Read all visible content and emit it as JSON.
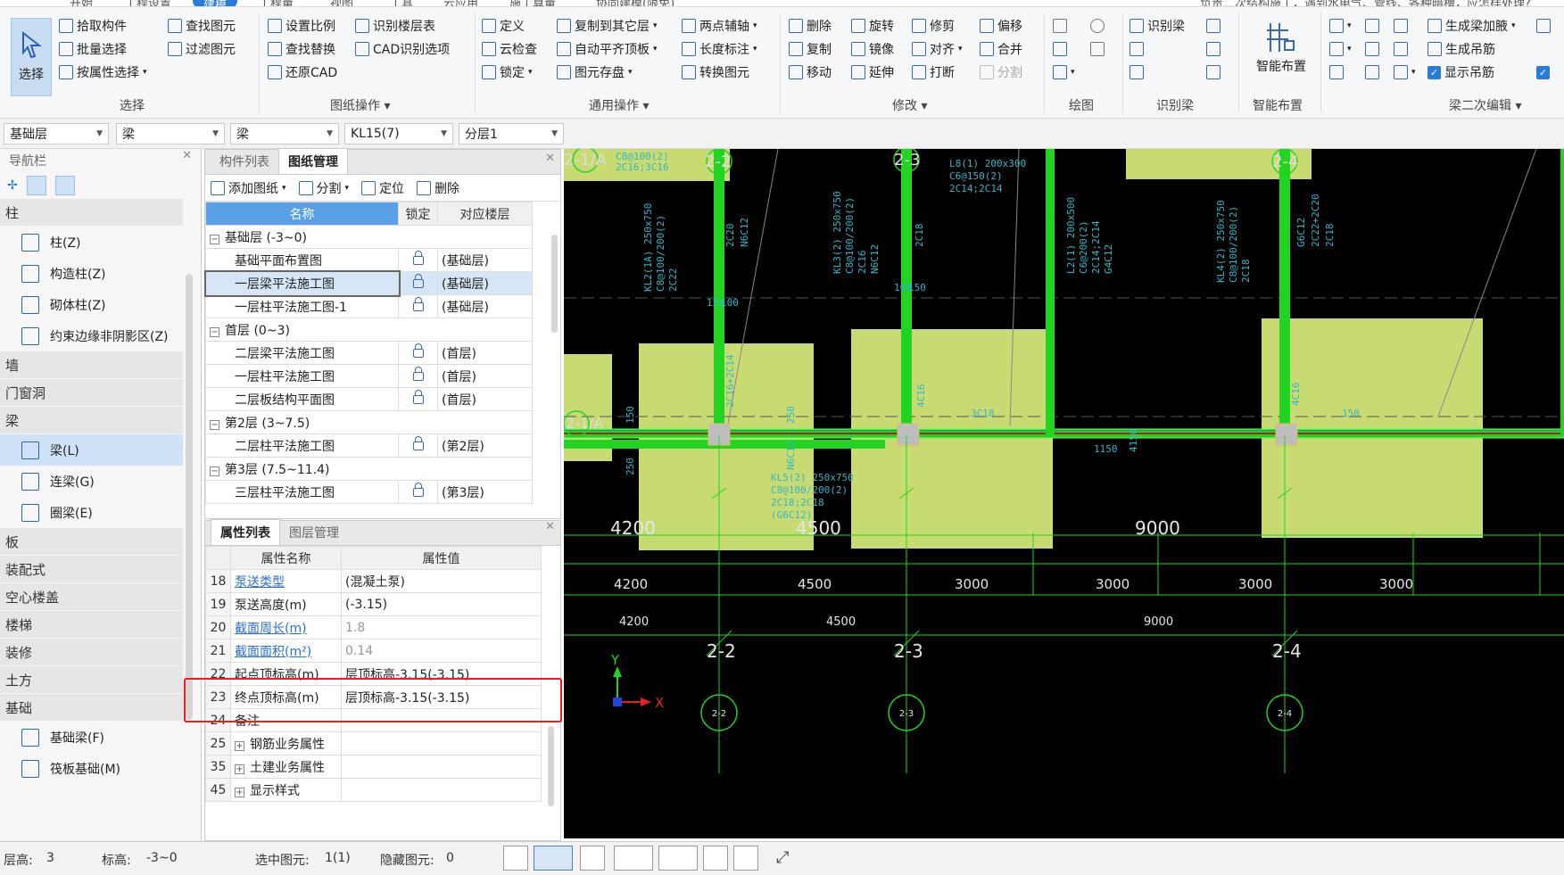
{
  "top_tabs": [
    {
      "label": "开始"
    },
    {
      "label": "工程设置"
    },
    {
      "label": "建模",
      "active": true
    },
    {
      "label": "视图"
    },
    {
      "label": "工程量"
    },
    {
      "label": "工具"
    },
    {
      "label": "云应用"
    },
    {
      "label": "施工算量"
    },
    {
      "label": "协同建模(限免)"
    }
  ],
  "top_right_text": "负责二次结构施工，遇到水电气、管线、各种暗槽，应怎样处理?",
  "ribbon": {
    "select_big": "选择",
    "groups": {
      "select": {
        "label": "选择",
        "items": [
          "拾取构件",
          "批量选择",
          "按属性选择",
          "查找图元",
          "过滤图元"
        ]
      },
      "drawing_ops": {
        "label": "图纸操作",
        "items": [
          "设置比例",
          "识别楼层表",
          "查找替换",
          "CAD识别选项",
          "还原CAD"
        ]
      },
      "common": {
        "label": "通用操作",
        "items": [
          "定义",
          "复制到其它层",
          "两点辅轴",
          "云检查",
          "自动平齐顶板",
          "长度标注",
          "锁定",
          "图元存盘",
          "转换图元"
        ]
      },
      "modify": {
        "label": "修改",
        "items": [
          "删除",
          "旋转",
          "修剪",
          "偏移",
          "复制",
          "镜像",
          "对齐",
          "合并",
          "移动",
          "延伸",
          "打断",
          "分割"
        ]
      },
      "draw": {
        "label": "绘图"
      },
      "recognize": {
        "label": "识别梁",
        "items": [
          "识别梁"
        ]
      },
      "smart": {
        "label": "智能布置",
        "items": [
          "智能布置"
        ]
      },
      "beam2": {
        "label": "梁二次编辑",
        "items": [
          "生成梁加腋",
          "生成吊筋",
          "显示吊筋"
        ]
      }
    }
  },
  "selectors": {
    "floor": "基础层",
    "category": "梁",
    "type": "梁",
    "element": "KL15(7)",
    "layer": "分层1"
  },
  "nav": {
    "title": "导航栏",
    "sections": [
      {
        "name": "柱",
        "items": [
          "柱(Z)",
          "构造柱(Z)",
          "砌体柱(Z)",
          "约束边缘非阴影区(Z)"
        ]
      },
      {
        "name": "墙",
        "items": []
      },
      {
        "name": "门窗洞",
        "items": []
      },
      {
        "name": "梁",
        "items": [
          "梁(L)",
          "连梁(G)",
          "圈梁(E)"
        ]
      },
      {
        "name": "板",
        "items": []
      },
      {
        "name": "装配式",
        "items": []
      },
      {
        "name": "空心楼盖",
        "items": []
      },
      {
        "name": "楼梯",
        "items": []
      },
      {
        "name": "装修",
        "items": []
      },
      {
        "name": "土方",
        "items": []
      },
      {
        "name": "基础",
        "items": [
          "基础梁(F)",
          "筏板基础(M)"
        ]
      }
    ],
    "selected_item": "梁(L)"
  },
  "drawing_panel": {
    "tabs": [
      "构件列表",
      "图纸管理"
    ],
    "active_tab": "图纸管理",
    "toolbar": [
      "添加图纸",
      "分割",
      "定位",
      "删除"
    ],
    "columns": [
      "名称",
      "锁定",
      "对应楼层"
    ],
    "rows": [
      {
        "kind": "group",
        "name": "基础层 (-3~0)"
      },
      {
        "kind": "item",
        "name": "基础平面布置图",
        "floor": "(基础层)"
      },
      {
        "kind": "item",
        "name": "一层梁平法施工图",
        "floor": "(基础层)",
        "selected": true
      },
      {
        "kind": "item",
        "name": "一层柱平法施工图-1",
        "floor": "(基础层)"
      },
      {
        "kind": "group",
        "name": "首层 (0~3)"
      },
      {
        "kind": "item",
        "name": "二层梁平法施工图",
        "floor": "(首层)"
      },
      {
        "kind": "item",
        "name": "一层柱平法施工图",
        "floor": "(首层)"
      },
      {
        "kind": "item",
        "name": "二层板结构平面图",
        "floor": "(首层)"
      },
      {
        "kind": "group",
        "name": "第2层 (3~7.5)"
      },
      {
        "kind": "item",
        "name": "二层柱平法施工图",
        "floor": "(第2层)"
      },
      {
        "kind": "group",
        "name": "第3层 (7.5~11.4)"
      },
      {
        "kind": "item",
        "name": "三层柱平法施工图",
        "floor": "(第3层)"
      }
    ]
  },
  "property_panel": {
    "tabs": [
      "属性列表",
      "图层管理"
    ],
    "active_tab": "属性列表",
    "columns": [
      "属性名称",
      "属性值"
    ],
    "rows": [
      {
        "no": "18",
        "name": "泵送类型",
        "value": "(混凝土泵)",
        "blue": true,
        "gray": false
      },
      {
        "no": "19",
        "name": "泵送高度(m)",
        "value": "(-3.15)",
        "blue": false,
        "gray": false
      },
      {
        "no": "20",
        "name": "截面周长(m)",
        "value": "1.8",
        "blue": true,
        "gray": true
      },
      {
        "no": "21",
        "name": "截面面积(m²)",
        "value": "0.14",
        "blue": true,
        "gray": true
      },
      {
        "no": "22",
        "name": "起点顶标高(m)",
        "value": "层顶标高-3.15(-3.15)",
        "blue": false,
        "gray": false
      },
      {
        "no": "23",
        "name": "终点顶标高(m)",
        "value": "层顶标高-3.15(-3.15)",
        "blue": false,
        "gray": false
      },
      {
        "no": "24",
        "name": "备注",
        "value": "",
        "blue": false,
        "gray": false
      },
      {
        "no": "25",
        "name": "钢筋业务属性",
        "value": "",
        "blue": false,
        "gray": false,
        "expand": true
      },
      {
        "no": "35",
        "name": "土建业务属性",
        "value": "",
        "blue": false,
        "gray": false,
        "expand": true
      },
      {
        "no": "45",
        "name": "显示样式",
        "value": "",
        "blue": false,
        "gray": false,
        "expand": true
      }
    ]
  },
  "cad": {
    "axis_labels_top": [
      "2-1/A",
      "2-2",
      "2-3",
      "2-4"
    ],
    "axis_label_left": "2-1/A",
    "spans_big": [
      "4200",
      "4500",
      "9000"
    ],
    "spans_row1": [
      "4200",
      "4500",
      "3000",
      "3000",
      "3000",
      "3000"
    ],
    "spans_row2": [
      "4200",
      "4500",
      "9000"
    ],
    "axis_labels_bottom": [
      "2-2",
      "2-3",
      "2-4"
    ],
    "circle_labels": [
      "2-2",
      "2-3",
      "2-4"
    ],
    "beam_notes": [
      "KL2(1A) 250x750",
      "C8@100/200(2)",
      "2C22",
      "KL3(2) 250x750",
      "C8@100/200(2)",
      "2C16",
      "N6C12",
      "L8(1) 200x300",
      "C6@150(2)",
      "2C14;2C14",
      "L2(1) 200x500",
      "C6@200(2)",
      "2C14;2C14",
      "G4C12",
      "KL4(2) 250x750",
      "C8@100/200(2)",
      "2C18",
      "KL5(2) 250x750",
      "C8@100/200(2)",
      "2C18;2C18",
      "(G6C12)",
      "C8@100(2)",
      "2C16;3C16",
      "2C20",
      "N6C12",
      "2C18",
      "2C18",
      "G6C12",
      "2C22+2C20",
      "2C16+2C14",
      "4C16",
      "3C18",
      "4C16",
      "150",
      "150",
      "100",
      "100",
      "150",
      "150",
      "250",
      "250",
      "N6C12",
      "1150",
      "4150"
    ],
    "compass": {
      "y": "Y",
      "x": "X"
    }
  },
  "status": {
    "floor_height_label": "层高:",
    "floor_height": "3",
    "elevation_label": "标高:",
    "elevation": "-3~0",
    "selected_label": "选中图元:",
    "selected": "1(1)",
    "hidden_label": "隐藏图元:",
    "hidden": "0"
  },
  "colors": {
    "accent": "#2a7bd8",
    "beam_green": "#22d322",
    "pile_fill": "#c8da72",
    "red_highlight": "#e8211f",
    "canvas_bg": "#000000",
    "property_blue": "#2a6fd6"
  }
}
